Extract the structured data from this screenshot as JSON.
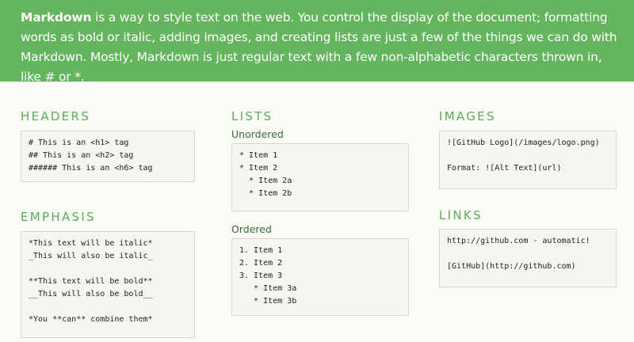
{
  "intro": {
    "bold": "Markdown",
    "text": " is a way to style text on the web. You control the display of the document; formatting words as bold or italic, adding images, and creating lists are just a few of the things we can do with Markdown. Mostly, Markdown is just regular text with a few non-alphabetic characters thrown in, like # or *."
  },
  "headers": {
    "title": "HEADERS",
    "lines": [
      "# This is an <h1> tag",
      "## This is an <h2> tag",
      "###### This is an <h6> tag"
    ]
  },
  "emphasis": {
    "title": "EMPHASIS",
    "lines": [
      "*This text will be italic*",
      "_This will also be italic_",
      "",
      "**This text will be bold**",
      "__This will also be bold__",
      "",
      "*You **can** combine them*"
    ]
  },
  "lists": {
    "title": "LISTS",
    "unordered_label": "Unordered",
    "unordered_lines": [
      "* Item 1",
      "* Item 2",
      "  * Item 2a",
      "  * Item 2b"
    ],
    "ordered_label": "Ordered",
    "ordered_lines": [
      "1. Item 1",
      "2. Item 2",
      "3. Item 3",
      "   * Item 3a",
      "   * Item 3b"
    ]
  },
  "images": {
    "title": "IMAGES",
    "lines": [
      "![GitHub Logo](/images/logo.png)",
      "",
      "Format: ![Alt Text](url)"
    ]
  },
  "links": {
    "title": "LINKS",
    "lines": [
      "http://github.com - automatic!",
      "",
      "[GitHub](http://github.com)"
    ]
  }
}
